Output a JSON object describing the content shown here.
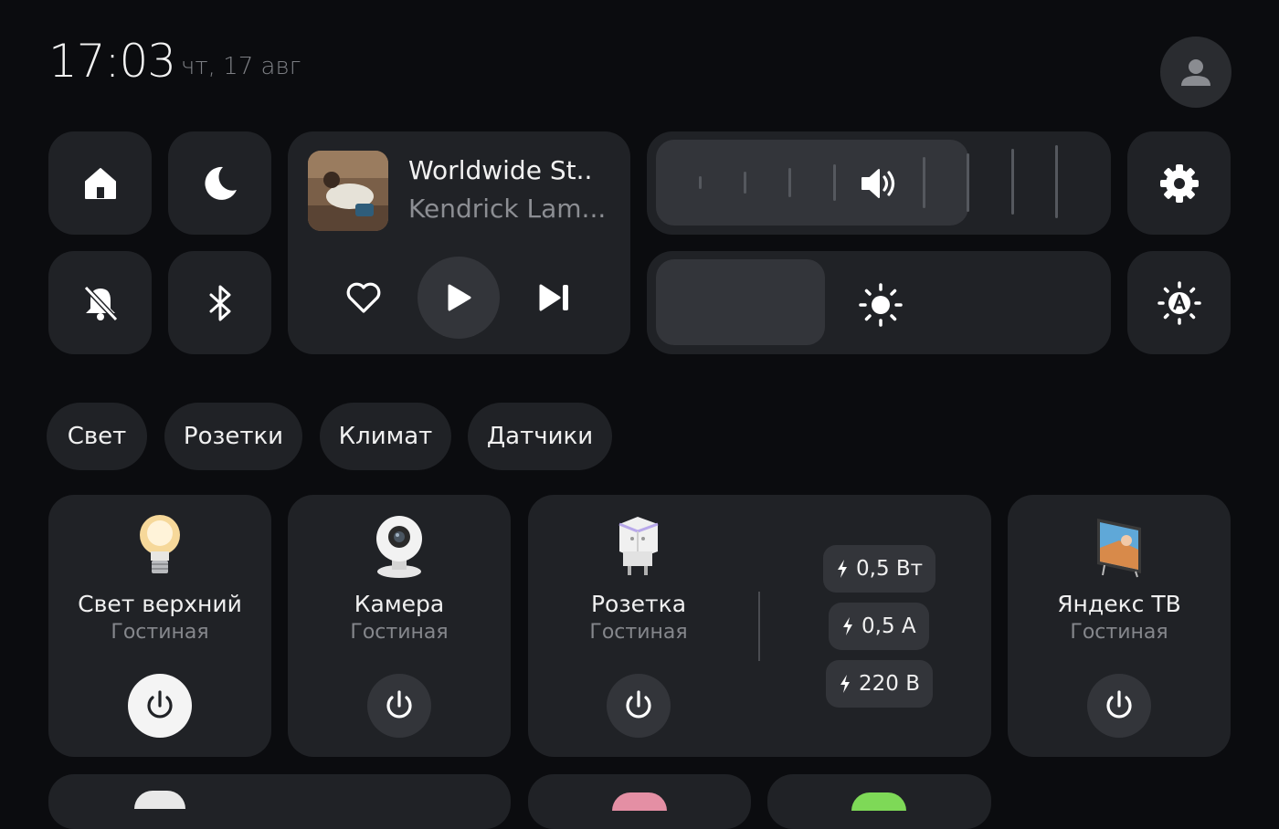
{
  "header": {
    "time": "17:03",
    "date": "чт, 17 авг"
  },
  "music": {
    "title": "Worldwide St..",
    "artist": "Kendrick Lam..."
  },
  "volume": {
    "level": 0.67
  },
  "brightness": {
    "level": 0.38
  },
  "chips": [
    "Свет",
    "Розетки",
    "Климат",
    "Датчики"
  ],
  "devices": [
    {
      "name": "Свет верхний",
      "room": "Гостиная",
      "on": true
    },
    {
      "name": "Камера",
      "room": "Гостиная",
      "on": false
    },
    {
      "name": "Розетка",
      "room": "Гостиная",
      "on": false,
      "metrics": [
        "0,5 Вт",
        "0,5 А",
        "220 В"
      ]
    },
    {
      "name": "Яндекс ТВ",
      "room": "Гостиная",
      "on": false
    }
  ],
  "colors": {
    "background": "#0b0c0f",
    "tile": "#202226",
    "control": "#33353a",
    "accent_on": "#f4f4f4"
  },
  "icons": [
    "home-icon",
    "moon-icon",
    "bell-off-icon",
    "bluetooth-icon",
    "heart-icon",
    "play-icon",
    "skip-next-icon",
    "volume-icon",
    "sun-icon",
    "gear-icon",
    "auto-brightness-icon",
    "user-icon",
    "power-icon",
    "lightning-icon"
  ]
}
